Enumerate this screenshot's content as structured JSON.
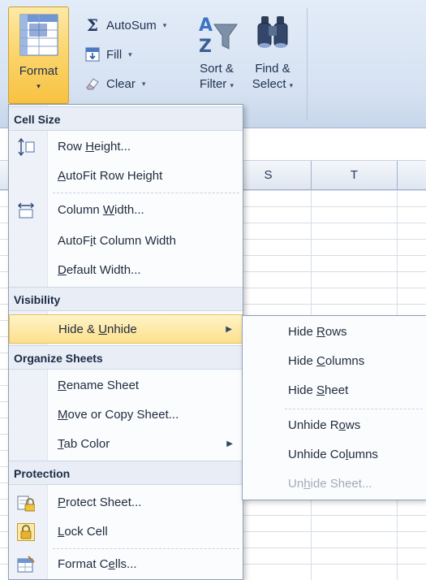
{
  "ribbon": {
    "format_button": {
      "label": "Format",
      "icon": "format-cells-grid-icon"
    },
    "autosum": {
      "label": "AutoSum",
      "icon": "sigma-icon"
    },
    "fill": {
      "label": "Fill",
      "icon": "fill-down-icon"
    },
    "clear": {
      "label": "Clear",
      "icon": "eraser-icon"
    },
    "sort_filter": {
      "label_line1": "Sort &",
      "label_line2": "Filter",
      "icon": "sort-az-funnel-icon"
    },
    "find_select": {
      "label_line1": "Find &",
      "label_line2": "Select",
      "icon": "binoculars-icon"
    },
    "dropdown_glyph": "▾"
  },
  "sheet": {
    "column_headers": [
      "S",
      "T"
    ]
  },
  "menu": {
    "sections": {
      "cell_size": "Cell Size",
      "visibility": "Visibility",
      "organize_sheets": "Organize Sheets",
      "protection": "Protection"
    },
    "items": {
      "row_height": {
        "pre": "Row ",
        "key": "H",
        "post": "eight...",
        "icon": "row-height-icon"
      },
      "autofit_row_height": {
        "pre": "",
        "key": "A",
        "post": "utoFit Row Height"
      },
      "column_width": {
        "pre": "Column ",
        "key": "W",
        "post": "idth...",
        "icon": "column-width-icon"
      },
      "autofit_column_width": {
        "pre": "AutoF",
        "key": "i",
        "post": "t Column Width"
      },
      "default_width": {
        "pre": "",
        "key": "D",
        "post": "efault Width..."
      },
      "hide_unhide": {
        "pre": "Hide & ",
        "key": "U",
        "post": "nhide"
      },
      "rename_sheet": {
        "pre": "",
        "key": "R",
        "post": "ename Sheet"
      },
      "move_copy_sheet": {
        "pre": "",
        "key": "M",
        "post": "ove or Copy Sheet..."
      },
      "tab_color": {
        "pre": "",
        "key": "T",
        "post": "ab Color"
      },
      "protect_sheet": {
        "pre": "",
        "key": "P",
        "post": "rotect Sheet...",
        "icon": "protect-sheet-icon"
      },
      "lock_cell": {
        "pre": "",
        "key": "L",
        "post": "ock Cell",
        "icon": "lock-icon"
      },
      "format_cells": {
        "pre": "Format C",
        "key": "e",
        "post": "lls...",
        "icon": "format-cells-icon"
      }
    },
    "submenu_arrow": "▶"
  },
  "submenu": {
    "hide_rows": {
      "pre": "Hide ",
      "key": "R",
      "post": "ows"
    },
    "hide_columns": {
      "pre": "Hide ",
      "key": "C",
      "post": "olumns"
    },
    "hide_sheet": {
      "pre": "Hide ",
      "key": "S",
      "post": "heet"
    },
    "unhide_rows": {
      "pre": "Unhide R",
      "key": "o",
      "post": "ws"
    },
    "unhide_columns": {
      "pre": "Unhide Co",
      "key": "l",
      "post": "umns"
    },
    "unhide_sheet": {
      "pre": "Un",
      "key": "h",
      "post": "ide Sheet...",
      "disabled": true
    }
  },
  "colors": {
    "ribbon_bg": "#d6e2f2",
    "format_button_active": "#fbd46a",
    "menu_highlight": "#fde08c",
    "section_header_bg": "#e9eef6",
    "disabled_text": "#a3abb8"
  }
}
